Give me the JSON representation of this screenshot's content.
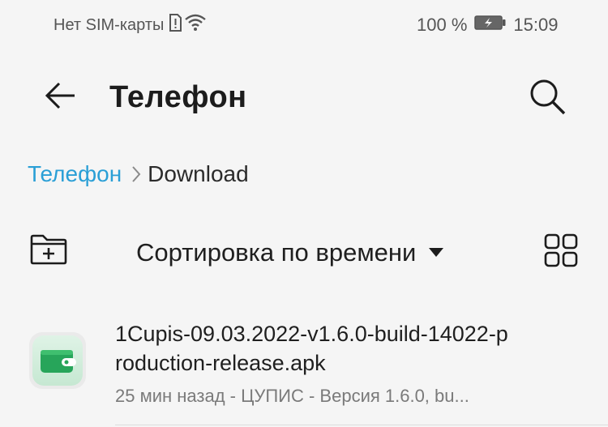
{
  "status_bar": {
    "sim_text": "Нет SIM-карты",
    "battery_percent": "100 %",
    "time": "15:09"
  },
  "header": {
    "title": "Телефон"
  },
  "breadcrumb": {
    "root": "Телефон",
    "current": "Download"
  },
  "toolbar": {
    "sort_label": "Сортировка по времени"
  },
  "files": [
    {
      "name": "1Cupis-09.03.2022-v1.6.0-build-14022-production-release.apk",
      "meta": "25 мин назад - ЦУПИС - Версия 1.6.0, bu..."
    }
  ],
  "colors": {
    "background": "#f5f5f5",
    "accent": "#2a9fd6",
    "app_icon_green": "#27a55a"
  },
  "icons": {
    "sim": "sim-alert-icon",
    "wifi": "wifi-icon",
    "battery": "battery-charging-icon",
    "back": "arrow-left-icon",
    "search": "search-icon",
    "breadcrumb_separator": "chevron-right-icon",
    "new_folder": "folder-plus-icon",
    "sort_caret": "caret-down-icon",
    "view_toggle": "grid-view-icon",
    "file": "wallet-app-icon"
  }
}
